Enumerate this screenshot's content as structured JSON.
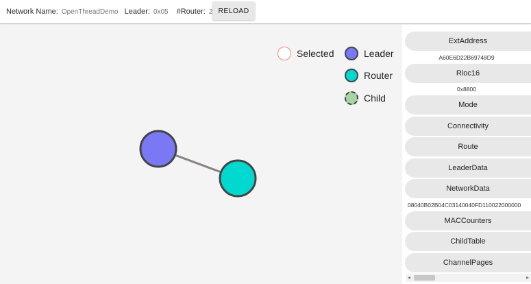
{
  "header": {
    "network_name_label": "Network Name:",
    "network_name_value": "OpenThreadDemo",
    "leader_label": "Leader:",
    "leader_value": "0x05",
    "router_count_label": "#Router:",
    "router_count_value": "2",
    "reload_label": "RELOAD"
  },
  "legend": {
    "selected_label": "Selected",
    "leader_label": "Leader",
    "router_label": "Router",
    "child_label": "Child"
  },
  "colors": {
    "leader": "#7b78f5",
    "router": "#00d8d0",
    "child": "#a8d5a4",
    "selected_border": "#f08585",
    "node_border": "#444444",
    "link": "#8a8282"
  },
  "side_panel": {
    "ext_address_label": "ExtAddress",
    "ext_address_value": "A60E6D22B69748D9",
    "rloc16_label": "Rloc16",
    "rloc16_value": "0x8800",
    "mode_label": "Mode",
    "connectivity_label": "Connectivity",
    "route_label": "Route",
    "leader_data_label": "LeaderData",
    "network_data_label": "NetworkData",
    "network_data_value": "08040B02B04C03140040FD110022000000",
    "mac_counters_label": "MACCounters",
    "child_table_label": "ChildTable",
    "channel_pages_label": "ChannelPages"
  }
}
